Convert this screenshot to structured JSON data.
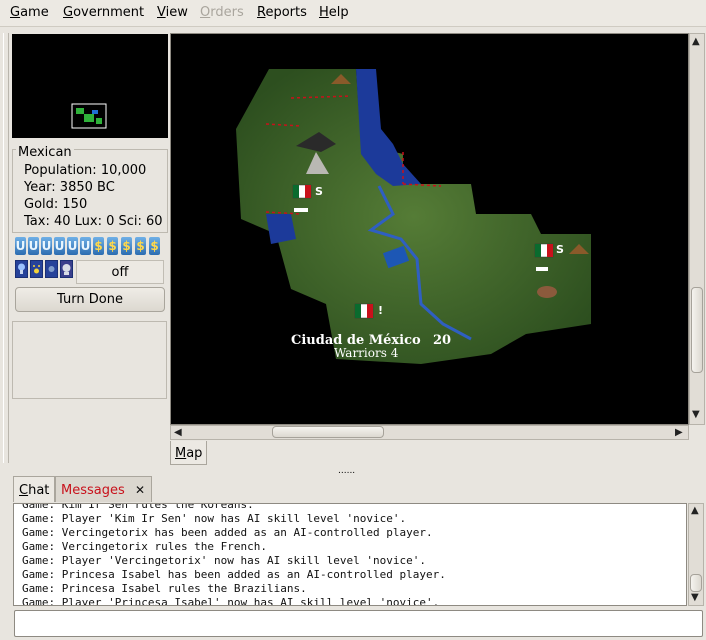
{
  "menubar": {
    "items": [
      {
        "label": "Game",
        "mnemonic": "G",
        "rest": "ame",
        "enabled": true
      },
      {
        "label": "Government",
        "mnemonic": "G",
        "rest": "overnment",
        "enabled": true
      },
      {
        "label": "View",
        "mnemonic": "V",
        "rest": "iew",
        "enabled": true
      },
      {
        "label": "Orders",
        "mnemonic": "O",
        "rest": "rders",
        "enabled": false
      },
      {
        "label": "Reports",
        "mnemonic": "R",
        "rest": "eports",
        "enabled": true
      },
      {
        "label": "Help",
        "mnemonic": "H",
        "rest": "elp",
        "enabled": true
      }
    ]
  },
  "info": {
    "nation": "Mexican",
    "population": "Population: 10,000",
    "year": "Year: 3850 BC",
    "gold": "Gold: 150",
    "rates": "Tax: 40 Lux: 0 Sci: 60"
  },
  "taxrates": {
    "icons": [
      "bulb",
      "bulb",
      "bulb",
      "bulb",
      "bulb",
      "bulb",
      "gold",
      "gold",
      "gold",
      "gold"
    ],
    "glyphs": {
      "bulb": "U",
      "gold": "$"
    }
  },
  "indicators": {
    "icons": [
      "research-bulb-icon",
      "global-warming-icon",
      "nuclear-winter-icon",
      "government-icon"
    ],
    "timeout_label": "off"
  },
  "turn_done_label": "Turn Done",
  "map": {
    "city_name": "Ciudad de México",
    "city_size": "20",
    "city_unit": "Warriors 4",
    "unit_badges": [
      "S",
      "!",
      "S"
    ],
    "colors": {
      "terrain": "#3f6b2a",
      "water": "#1c3a9a",
      "border": "#c8111b"
    }
  },
  "map_tab": {
    "mnemonic": "M",
    "rest": "ap"
  },
  "pane_grip": "......",
  "tabs": {
    "chat": {
      "mnemonic": "C",
      "rest": "hat"
    },
    "messages": "Messages",
    "close_glyph": "✕"
  },
  "log": {
    "lines": [
      "Game: Kim Ir Sen rules the Koreans.",
      "Game: Player 'Kim Ir Sen' now has AI skill level 'novice'.",
      "Game: Vercingetorix has been added as an AI-controlled player.",
      "Game: Vercingetorix rules the French.",
      "Game: Player 'Vercingetorix' now has AI skill level 'novice'.",
      "Game: Princesa Isabel has been added as an AI-controlled player.",
      "Game: Princesa Isabel rules the Brazilians.",
      "Game: Player 'Princesa Isabel' now has AI skill level 'novice'."
    ]
  },
  "chat_input": {
    "value": ""
  }
}
